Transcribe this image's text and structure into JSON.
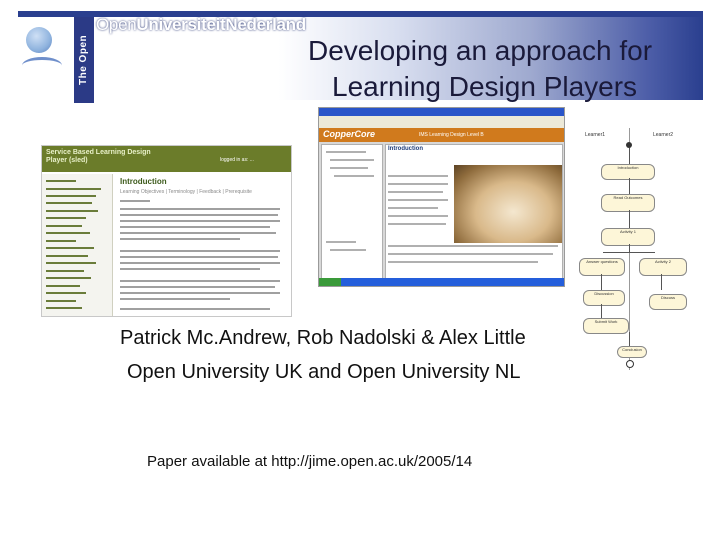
{
  "header": {
    "logo_vertical_text": "The Open University",
    "logo_text_light": "Open",
    "logo_text_bold": "UniversiteitNederland",
    "title_line1": "Developing an approach for",
    "title_line2": "Learning Design Players"
  },
  "screenshot_left": {
    "header_title": "Service Based Learning Design Player (sled)",
    "header_right": "logged in as: ...",
    "main_heading": "Introduction",
    "tabs": "Learning Objectives | Terminology | Feedback | Prerequisite"
  },
  "screenshot_center": {
    "banner_text": "CopperCore",
    "banner_right": "IMS Learning Design Level B",
    "panel_heading": "Introduction"
  },
  "diagram": {
    "col_left": "Learner1",
    "col_right": "Learner2",
    "nodes": [
      "Introduction",
      "Read Outcomes",
      "Activity 1",
      "Answer questions",
      "Activity 2",
      "Discussion",
      "Discuss",
      "Submit Work",
      "Conclusion"
    ]
  },
  "body": {
    "authors": "Patrick Mc.Andrew, Rob Nadolski & Alex Little",
    "affiliations": "Open University UK and Open University NL",
    "paper_link": "Paper available at http://jime.open.ac.uk/2005/14"
  },
  "colors": {
    "banner_blue": "#2a3f8f",
    "sled_green": "#6b7c2a",
    "coppercore_orange": "#d07a1d"
  }
}
